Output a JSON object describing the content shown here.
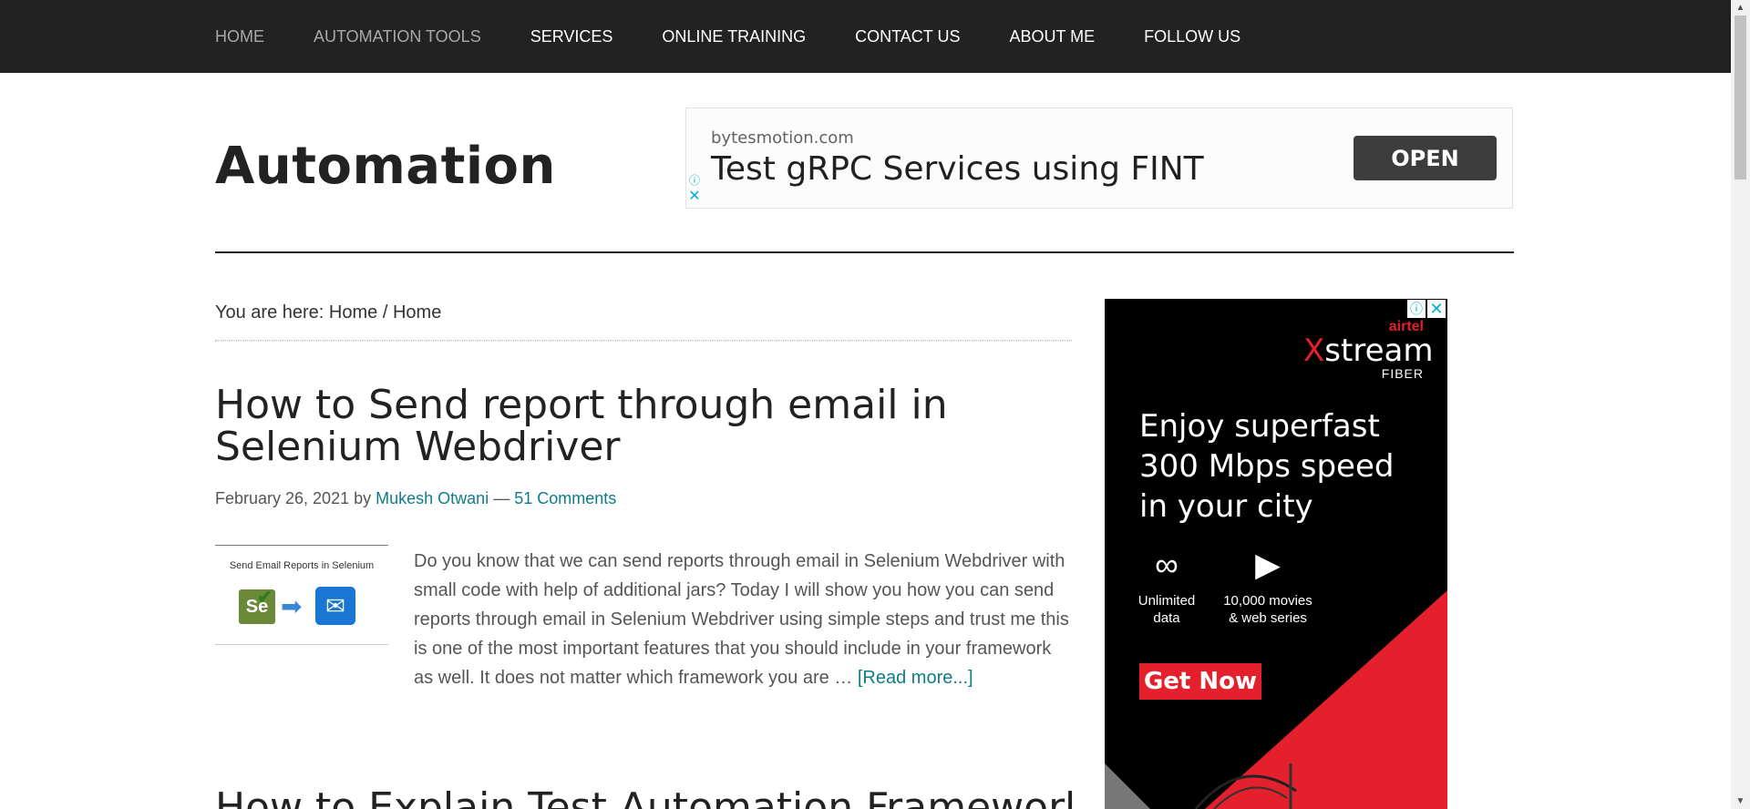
{
  "nav": {
    "items": [
      {
        "label": "HOME",
        "dim": true
      },
      {
        "label": "AUTOMATION TOOLS",
        "dim": true
      },
      {
        "label": "SERVICES",
        "dim": false
      },
      {
        "label": "ONLINE TRAINING",
        "dim": false
      },
      {
        "label": "CONTACT US",
        "dim": false
      },
      {
        "label": "ABOUT ME",
        "dim": false
      },
      {
        "label": "FOLLOW US",
        "dim": false
      }
    ]
  },
  "site": {
    "title": "Automation"
  },
  "top_ad": {
    "domain": "bytesmotion.com",
    "headline": "Test gRPC Services using FINT",
    "button": "OPEN",
    "info_glyph": "ⓘ",
    "close_glyph": "✕"
  },
  "breadcrumb": {
    "prefix": "You are here:",
    "home": "Home",
    "separator": "/",
    "current": "Home"
  },
  "post": {
    "title": "How to Send report through email in Selenium Webdriver",
    "date": "February 26, 2021",
    "by": "by",
    "author": "Mukesh Otwani",
    "dash": "—",
    "comments": "51 Comments",
    "thumb_caption": "Send Email Reports in Selenium",
    "thumb_se": "Se",
    "excerpt": "Do you know that we can send reports through email in Selenium Webdriver with small code with help of additional jars? Today I will show you how you can send reports through email in Selenium Webdriver using simple steps and trust me this is one of the most important features that you should include in your framework as well. It does not matter which framework you are …",
    "read_more": "[Read more...]"
  },
  "next_post": {
    "title": "How to Explain Test Automation Framework"
  },
  "side_ad": {
    "brand_top": "airtel",
    "brand_x": "X",
    "brand_name": "stream",
    "brand_sub": "FIBER",
    "tagline": "Enjoy superfast 300 Mbps speed in your city",
    "feature1": "Unlimited data",
    "feature2": "10,000 movies & web series",
    "cta": "Get Now",
    "info_glyph": "ⓘ",
    "close_glyph": "✕"
  },
  "colors": {
    "nav_bg": "#222222",
    "link": "#0e7d87",
    "ad_red": "#e4202c"
  }
}
